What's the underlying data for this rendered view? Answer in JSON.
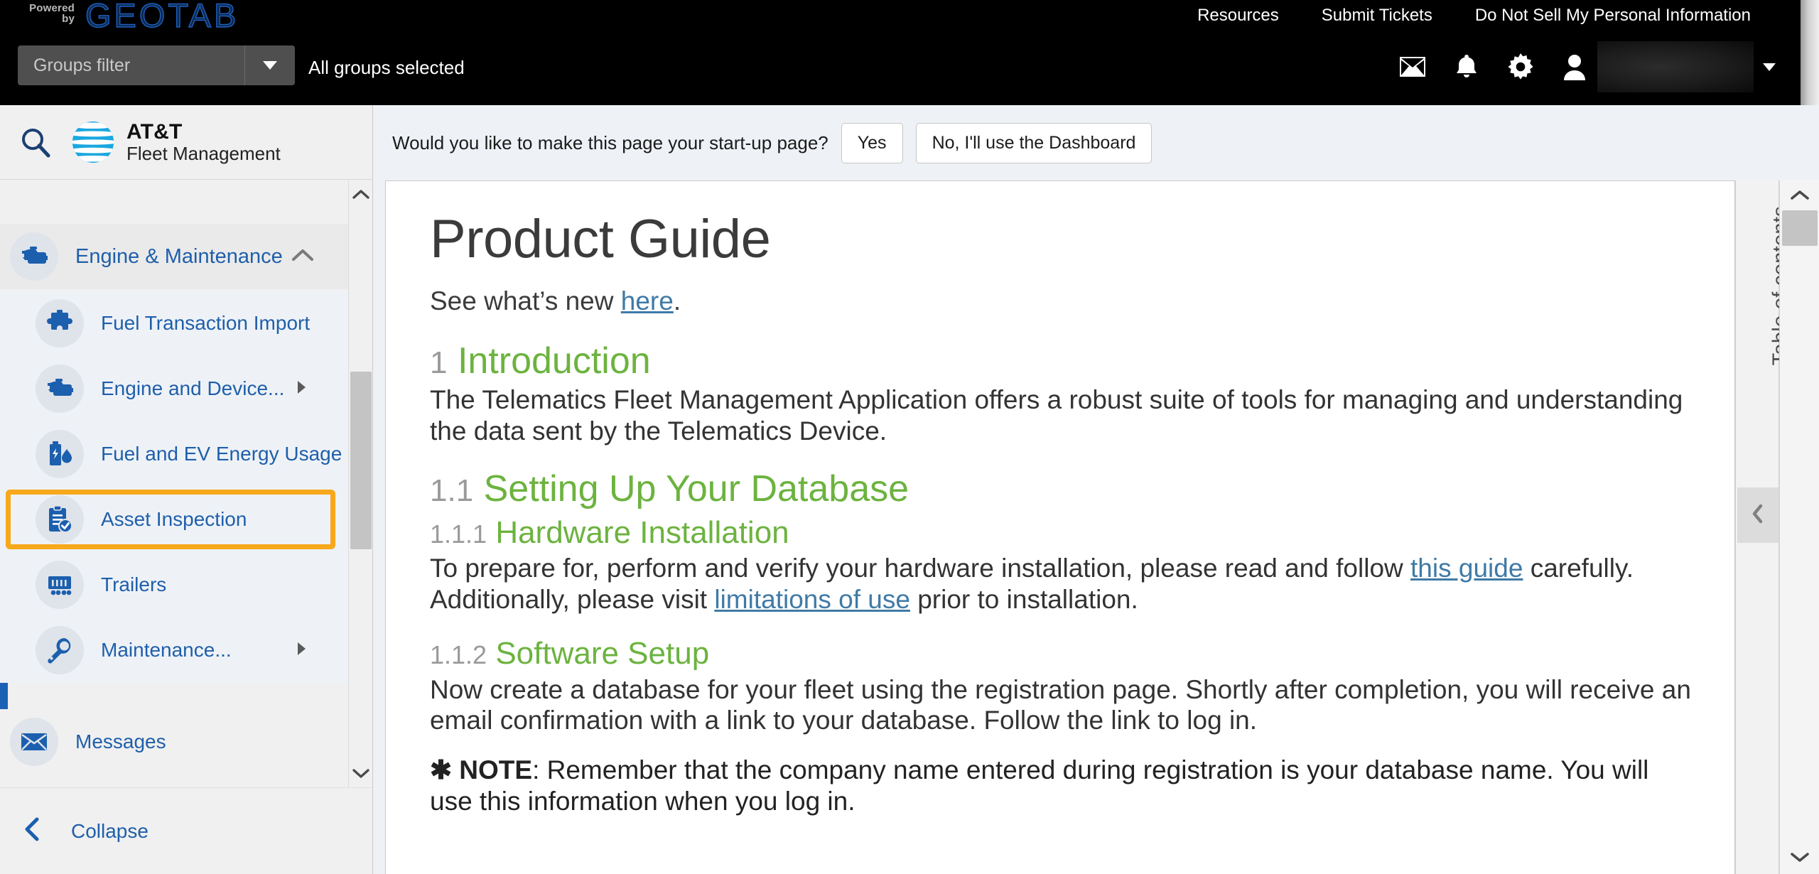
{
  "topbar": {
    "powered_by_line1": "Powered",
    "powered_by_line2": "by",
    "brand_logo": "GEOTAB",
    "groups_filter_placeholder": "Groups filter",
    "groups_selected_text": "All groups selected",
    "links": [
      {
        "label": "Resources"
      },
      {
        "label": "Submit Tickets"
      },
      {
        "label": "Do Not Sell My Personal Information"
      }
    ],
    "icons": [
      {
        "name": "mail-icon"
      },
      {
        "name": "bell-icon"
      },
      {
        "name": "gear-icon"
      },
      {
        "name": "user-icon"
      }
    ],
    "user_name": ""
  },
  "sidebar": {
    "search_icon": "search-icon",
    "brand_line1": "AT&T",
    "brand_line2": "Fleet Management",
    "group": {
      "label": "Engine & Maintenance",
      "icon": "engine-icon",
      "expanded": true
    },
    "items": [
      {
        "label": "Fuel Transaction Import",
        "icon": "puzzle-icon",
        "has_submenu": false
      },
      {
        "label": "Engine and Device...",
        "icon": "engine-icon",
        "has_submenu": true
      },
      {
        "label": "Fuel and EV Energy Usage",
        "icon": "fuel-ev-icon",
        "has_submenu": false
      },
      {
        "label": "Asset Inspection",
        "icon": "clipboard-check-icon",
        "has_submenu": false,
        "highlighted": true
      },
      {
        "label": "Trailers",
        "icon": "trailer-icon",
        "has_submenu": false
      },
      {
        "label": "Maintenance...",
        "icon": "wrench-icon",
        "has_submenu": true
      }
    ],
    "messages": {
      "label": "Messages",
      "icon": "mail-icon"
    },
    "collapse": {
      "label": "Collapse",
      "icon": "chevron-left-icon"
    },
    "highlight_color": "#F7A81B",
    "accent_color": "#1b62b5"
  },
  "startup_prompt": {
    "question": "Would you like to make this page your start-up page?",
    "yes_label": "Yes",
    "no_label": "No, I'll use the Dashboard"
  },
  "document": {
    "title": "Product Guide",
    "subtitle_before": "See what’s new ",
    "subtitle_link": "here",
    "subtitle_after": ".",
    "sections": [
      {
        "number": "1",
        "heading": "Introduction",
        "level": 2,
        "body": "The Telematics Fleet Management Application offers a robust suite of tools for managing and understanding the data sent by the Telematics Device."
      },
      {
        "number": "1.1",
        "heading": "Setting Up Your Database",
        "level": 2,
        "body": ""
      },
      {
        "number": "1.1.1",
        "heading": "Hardware Installation",
        "level": 3,
        "body_part1": "To prepare for, perform and verify your hardware installation, please read and follow ",
        "link1": "this guide",
        "body_part2": " carefully. Additionally, please visit ",
        "link2": "limitations of use",
        "body_part3": " prior to installation."
      },
      {
        "number": "1.1.2",
        "heading": "Software Setup",
        "level": 3,
        "body": "Now create a database for your fleet using the registration page. Shortly after completion, you will receive an email confirmation with a link to your database. Follow the link to log in."
      }
    ],
    "note": {
      "marker": "✱",
      "label": "NOTE",
      "text": ": Remember that the company name entered during registration is your database name. You will use this information when you log in."
    },
    "heading_color": "#6CB33F",
    "link_color": "#3f7aa6"
  },
  "toc": {
    "label": "Table of contents",
    "collapse_icon": "chevron-left-icon"
  },
  "scrollbars": {
    "up_icon": "chevron-up-icon",
    "down_icon": "chevron-down-icon"
  }
}
